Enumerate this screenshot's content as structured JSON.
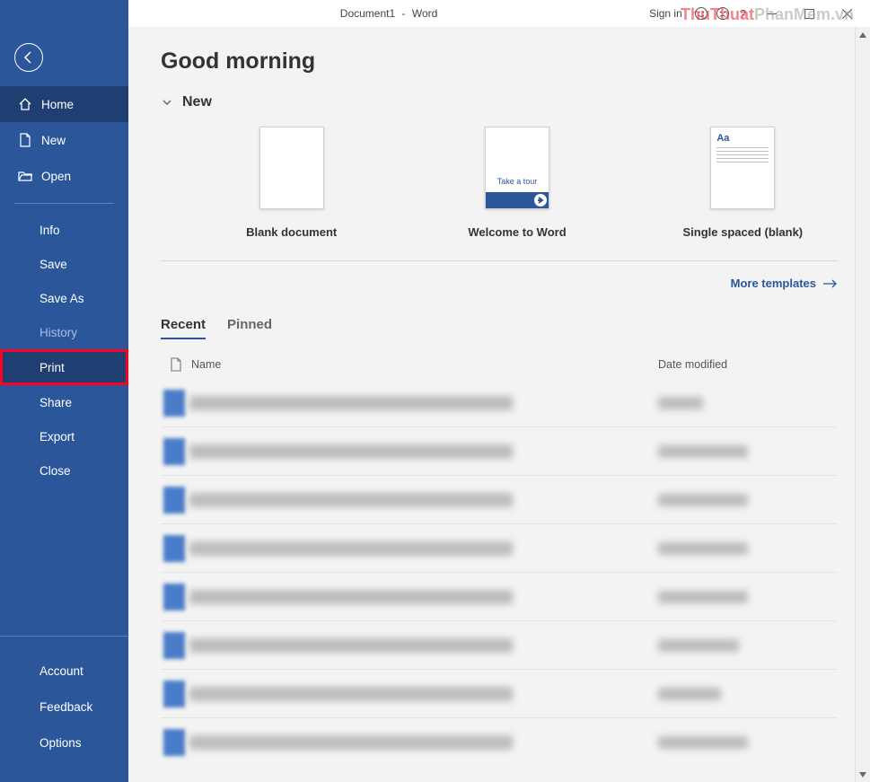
{
  "titlebar": {
    "doc_name": "Document1",
    "app_name": "Word",
    "sign_in": "Sign in"
  },
  "watermark": {
    "part1": "ThuThuat",
    "part2": "PhanMem",
    "part3": ".vn"
  },
  "sidebar": {
    "home": "Home",
    "new": "New",
    "open": "Open",
    "info": "Info",
    "save": "Save",
    "save_as": "Save As",
    "history": "History",
    "print": "Print",
    "share": "Share",
    "export": "Export",
    "close": "Close",
    "account": "Account",
    "feedback": "Feedback",
    "options": "Options"
  },
  "main": {
    "greeting": "Good morning",
    "new_header": "New",
    "templates": {
      "blank": "Blank document",
      "welcome": "Welcome to Word",
      "tour_text": "Take a tour",
      "single": "Single spaced (blank)",
      "single_aa": "Aa"
    },
    "more_templates": "More templates",
    "tabs": {
      "recent": "Recent",
      "pinned": "Pinned"
    },
    "list_headers": {
      "name": "Name",
      "date": "Date modified"
    }
  }
}
